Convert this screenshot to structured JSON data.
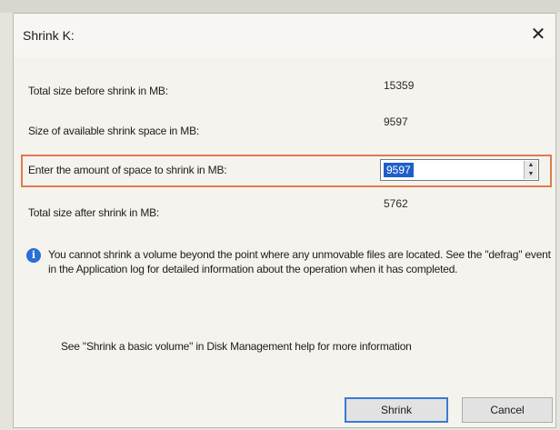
{
  "dialog": {
    "title": "Shrink K:",
    "close_glyph": "✕"
  },
  "fields": {
    "total_before_label": "Total size before shrink in MB:",
    "total_before_value": "15359",
    "available_label": "Size of available shrink space in MB:",
    "available_value": "9597",
    "amount_label": "Enter the amount of space to shrink in MB:",
    "amount_value": "9597",
    "total_after_label": "Total size after shrink in MB:",
    "total_after_value": "5762"
  },
  "info": {
    "icon": "info-icon",
    "icon_glyph": "i",
    "text": "You cannot shrink a volume beyond the point where any unmovable files are located. See the \"defrag\" event in the Application log for detailed information about the operation when it has completed."
  },
  "help": {
    "text": "See \"Shrink a basic volume\" in Disk Management help for more information"
  },
  "buttons": {
    "shrink_label": "Shrink",
    "cancel_label": "Cancel"
  },
  "spinner": {
    "up_glyph": "▲",
    "down_glyph": "▼"
  },
  "colors": {
    "highlight": "#e07b4e",
    "selection": "#1e5fc9",
    "primary_border": "#3a7bd5",
    "info_icon": "#2a6fd6"
  }
}
